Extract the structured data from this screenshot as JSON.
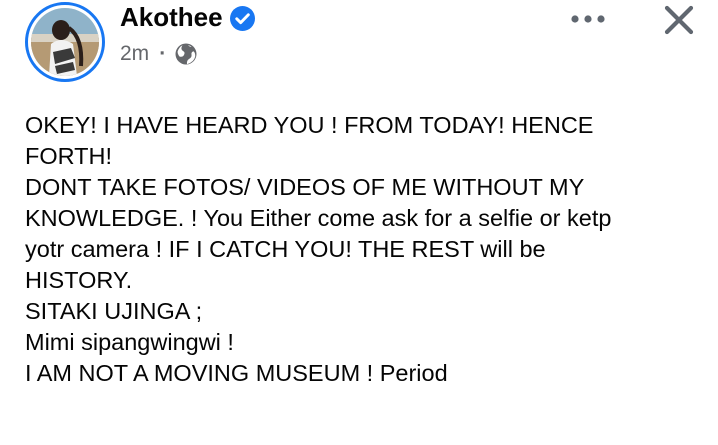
{
  "post": {
    "author": {
      "name": "Akothee",
      "verified": true,
      "avatar": "profile-photo"
    },
    "timestamp": "2m",
    "separator": "·",
    "audience_icon": "globe-icon",
    "more_icon": "more-horizontal-icon",
    "close_icon": "close-icon",
    "lines": [
      "OKEY!  I HAVE HEARD YOU ! FROM TODAY!  HENCE",
      "FORTH!",
      "DONT TAKE FOTOS/ VIDEOS OF ME WITHOUT MY",
      "KNOWLEDGE. ! You Either come ask for a selfie or ketp",
      "yotr camera ! IF I CATCH YOU! THE REST will be",
      "HISTORY.",
      "SITAKI UJINGA ;",
      "Mimi sipangwingwi !",
      "I AM NOT A MOVING MUSEUM ! Period"
    ]
  },
  "colors": {
    "accent": "#1877f2",
    "text": "#050505",
    "secondary": "#65676b",
    "icon": "#606770"
  }
}
